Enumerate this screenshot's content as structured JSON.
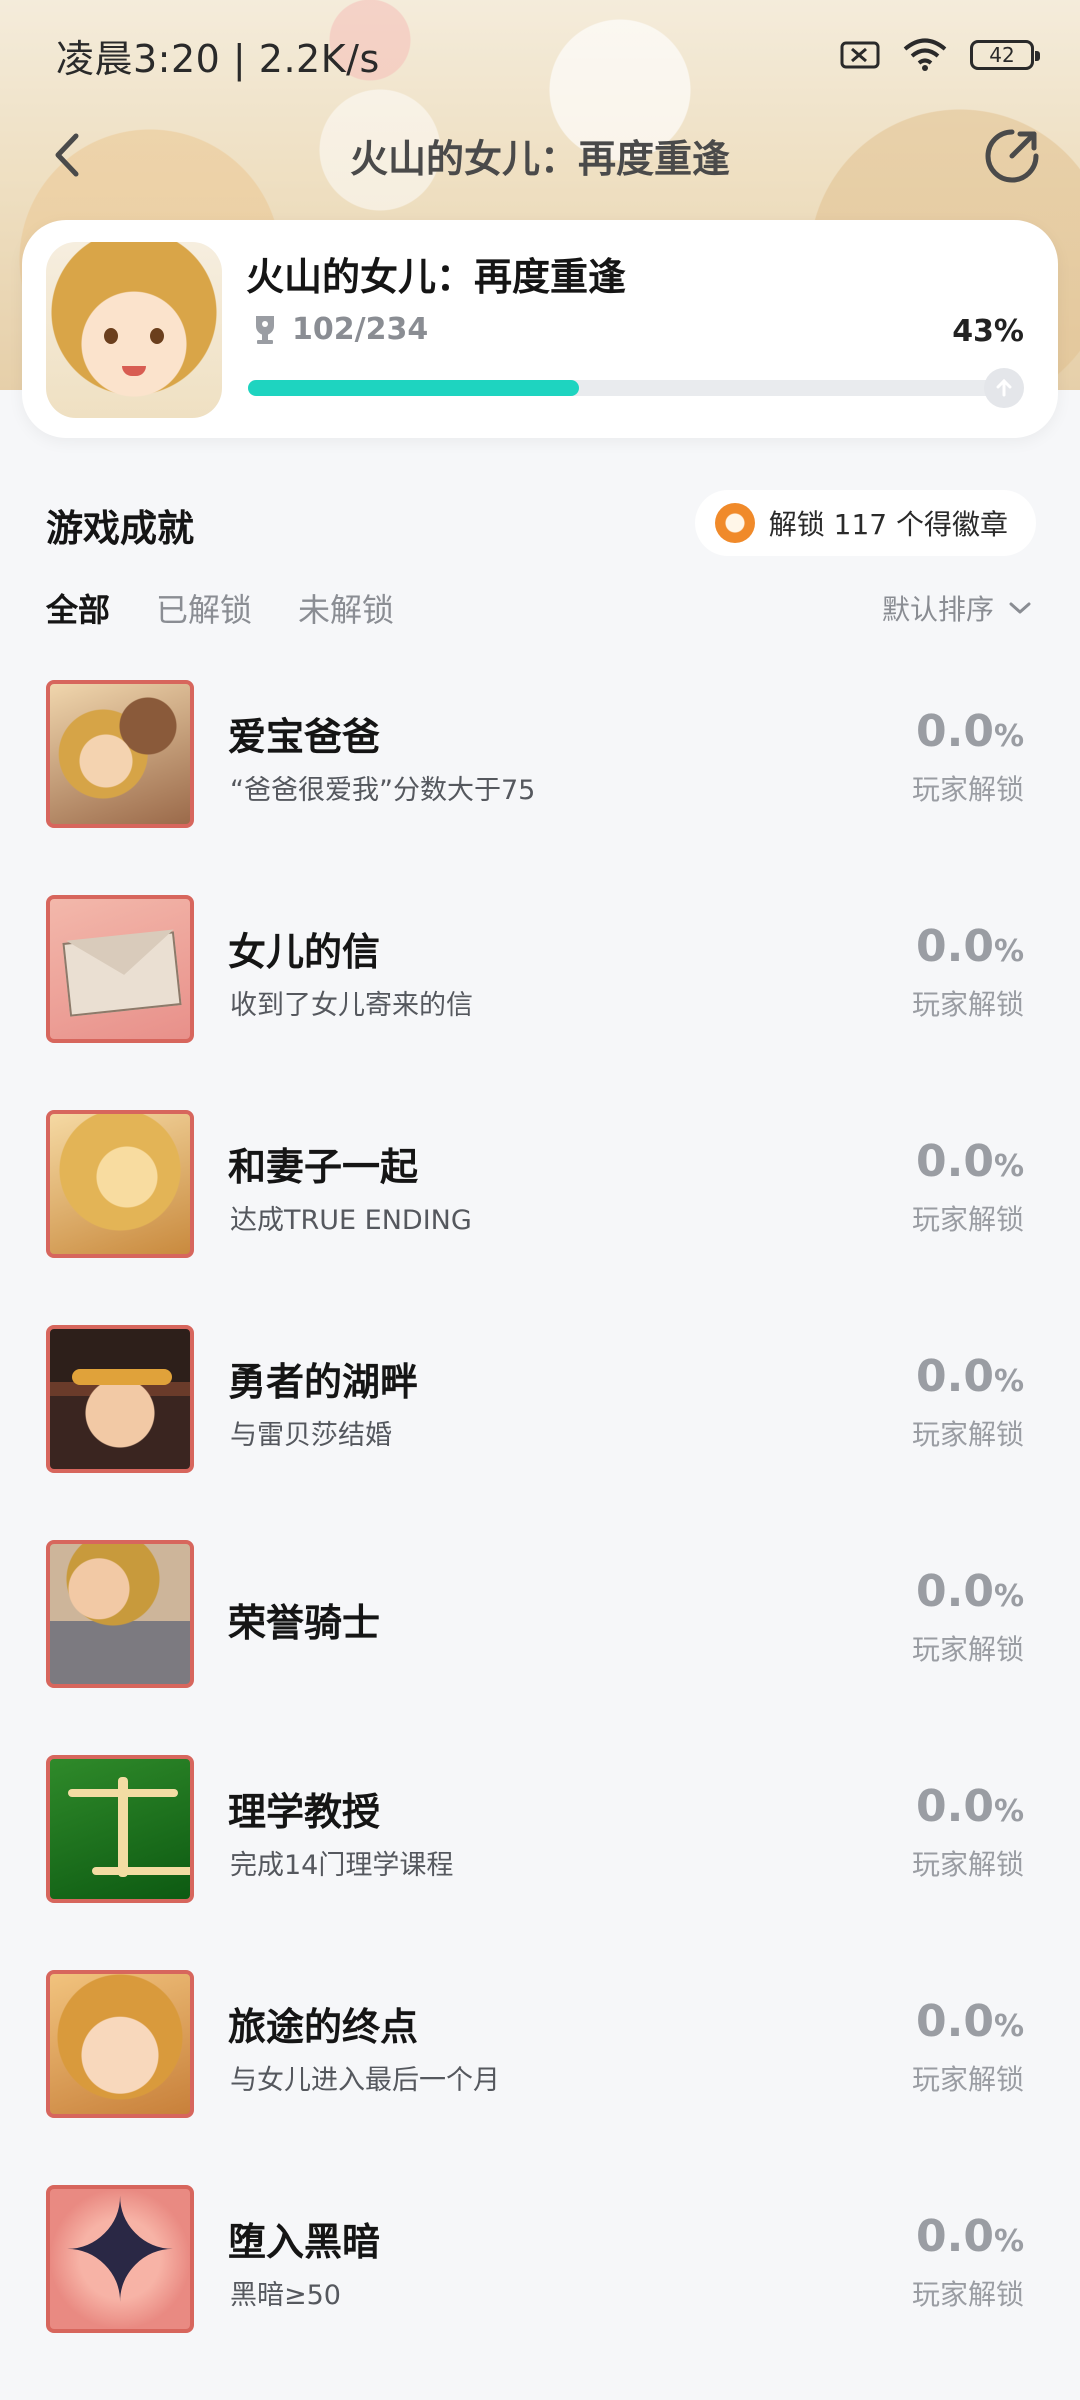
{
  "status_bar": {
    "time": "凌晨3:20 | 2.2K/s",
    "battery": "42",
    "icons": [
      "sim-off-icon",
      "wifi-icon",
      "battery-icon"
    ]
  },
  "nav": {
    "title": "火山的女儿：再度重逢",
    "back_icon": "back-arrow-icon",
    "share_icon": "share-icon"
  },
  "game": {
    "name": "火山的女儿：再度重逢",
    "trophy_count": "102/234",
    "progress_percent": "43%",
    "progress_fraction": 0.43
  },
  "section": {
    "title": "游戏成就",
    "badge_text": "解锁 117 个得徽章"
  },
  "tabs": [
    {
      "label": "全部",
      "active": true
    },
    {
      "label": "已解锁",
      "active": false
    },
    {
      "label": "未解锁",
      "active": false
    }
  ],
  "sort_label": "默认排序",
  "achievements": [
    {
      "title": "爱宝爸爸",
      "desc": "“爸爸很爱我”分数大于75",
      "rate": "0.0",
      "unit": "%",
      "rate_label": "玩家解锁"
    },
    {
      "title": "女儿的信",
      "desc": "收到了女儿寄来的信",
      "rate": "0.0",
      "unit": "%",
      "rate_label": "玩家解锁"
    },
    {
      "title": "和妻子一起",
      "desc": "达成TRUE ENDING",
      "rate": "0.0",
      "unit": "%",
      "rate_label": "玩家解锁"
    },
    {
      "title": "勇者的湖畔",
      "desc": "与雷贝莎结婚",
      "rate": "0.0",
      "unit": "%",
      "rate_label": "玩家解锁"
    },
    {
      "title": "荣誉骑士",
      "desc": "",
      "rate": "0.0",
      "unit": "%",
      "rate_label": "玩家解锁"
    },
    {
      "title": "理学教授",
      "desc": "完成14门理学课程",
      "rate": "0.0",
      "unit": "%",
      "rate_label": "玩家解锁"
    },
    {
      "title": "旅途的终点",
      "desc": "与女儿进入最后一个月",
      "rate": "0.0",
      "unit": "%",
      "rate_label": "玩家解锁"
    },
    {
      "title": "堕入黑暗",
      "desc": "黑暗≥50",
      "rate": "0.0",
      "unit": "%",
      "rate_label": "玩家解锁"
    }
  ],
  "colors": {
    "progress_fill": "#1ed4c0",
    "icon_border": "#d7665d",
    "badge_orange": "#f08a2a"
  }
}
